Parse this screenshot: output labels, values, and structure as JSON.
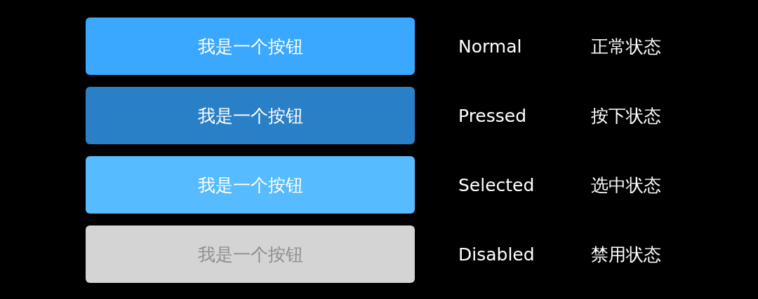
{
  "rows": [
    {
      "kind": "normal",
      "button_label": "我是一个按钮",
      "state_name": "Normal",
      "state_name_zh": "正常状态"
    },
    {
      "kind": "pressed",
      "button_label": "我是一个按钮",
      "state_name": "Pressed",
      "state_name_zh": "按下状态"
    },
    {
      "kind": "selected",
      "button_label": "我是一个按钮",
      "state_name": "Selected",
      "state_name_zh": "选中状态"
    },
    {
      "kind": "disabled",
      "button_label": "我是一个按钮",
      "state_name": "Disabled",
      "state_name_zh": "禁用状态"
    }
  ]
}
